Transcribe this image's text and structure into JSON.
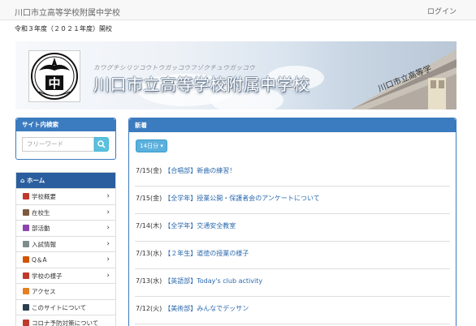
{
  "header": {
    "site_title": "川口市立高等学校附属中学校",
    "login_label": "ログイン"
  },
  "notice": "令和３年度（２０２１年度）開校",
  "banner": {
    "kana": "カワグチシリツコウトウガッコウフゾクチュウガッコウ",
    "school_name": "川口市立高等学校附属中学校",
    "logo_char": "中",
    "building_text": "川口市立高等学"
  },
  "search": {
    "heading": "サイト内検索",
    "placeholder": "フリーワード"
  },
  "menu": {
    "home": "ホーム",
    "items": [
      {
        "label": "学校概要",
        "icon": "school-icon",
        "color": "#c0392b",
        "has_children": true
      },
      {
        "label": "在校生",
        "icon": "students-icon",
        "color": "#7f5a3c",
        "has_children": true
      },
      {
        "label": "部活動",
        "icon": "club-icon",
        "color": "#8e44ad",
        "has_children": true
      },
      {
        "label": "入試情報",
        "icon": "document-icon",
        "color": "#7f8c8d",
        "has_children": true
      },
      {
        "label": "Q＆A",
        "icon": "qa-icon",
        "color": "#d35400",
        "has_children": true
      },
      {
        "label": "学校の様子",
        "icon": "school-life-icon",
        "color": "#c0392b",
        "has_children": true
      },
      {
        "label": "アクセス",
        "icon": "access-icon",
        "color": "#e67e22",
        "has_children": false
      },
      {
        "label": "このサイトについて",
        "icon": "monitor-icon",
        "color": "#2c3e50",
        "has_children": false
      },
      {
        "label": "コロナ予防対策について",
        "icon": "virus-icon",
        "color": "#c0392b",
        "has_children": false
      }
    ]
  },
  "news": {
    "heading": "新着",
    "period_label": "14日分",
    "items": [
      {
        "date": "7/15(金)",
        "title": "【合唱部】新曲の練習！"
      },
      {
        "date": "7/15(金)",
        "title": "【全学年】授業公開・保護者会のアンケートについて"
      },
      {
        "date": "7/14(木)",
        "title": "【全学年】交通安全教室"
      },
      {
        "date": "7/13(水)",
        "title": "【２年生】道徳の授業の様子"
      },
      {
        "date": "7/13(水)",
        "title": "【英語部】Today's club activity"
      },
      {
        "date": "7/12(火)",
        "title": "【美術部】みんなでデッサン"
      }
    ]
  },
  "colors": {
    "accent": "#3b7bbf",
    "menu_home": "#2b5e9e",
    "link": "#2a68ad",
    "search_button": "#5bc0de"
  }
}
